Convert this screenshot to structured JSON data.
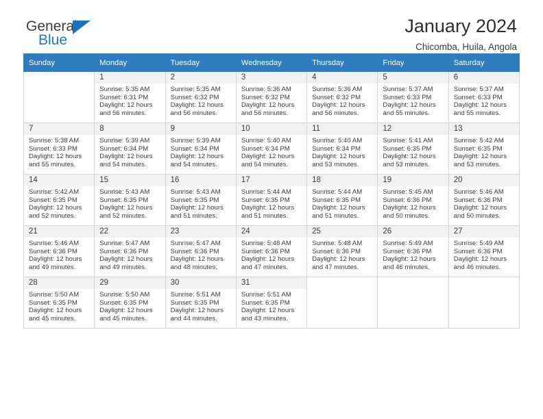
{
  "brand": {
    "line1": "General",
    "line2": "Blue",
    "triangle_icon": "blue-triangle-icon",
    "accent_color": "#1a72b8"
  },
  "header": {
    "title": "January 2024",
    "subtitle": "Chicomba, Huila, Angola"
  },
  "calendar": {
    "header_bg": "#2f7cbf",
    "weekday_headers": [
      "Sunday",
      "Monday",
      "Tuesday",
      "Wednesday",
      "Thursday",
      "Friday",
      "Saturday"
    ],
    "labels": {
      "sunrise": "Sunrise:",
      "sunset": "Sunset:",
      "daylight": "Daylight:"
    },
    "weeks": [
      [
        {
          "day": "",
          "lines": []
        },
        {
          "day": "1",
          "lines": [
            "Sunrise: 5:35 AM",
            "Sunset: 6:31 PM",
            "Daylight: 12 hours",
            "and 56 minutes."
          ]
        },
        {
          "day": "2",
          "lines": [
            "Sunrise: 5:35 AM",
            "Sunset: 6:32 PM",
            "Daylight: 12 hours",
            "and 56 minutes."
          ]
        },
        {
          "day": "3",
          "lines": [
            "Sunrise: 5:36 AM",
            "Sunset: 6:32 PM",
            "Daylight: 12 hours",
            "and 56 minutes."
          ]
        },
        {
          "day": "4",
          "lines": [
            "Sunrise: 5:36 AM",
            "Sunset: 6:32 PM",
            "Daylight: 12 hours",
            "and 56 minutes."
          ]
        },
        {
          "day": "5",
          "lines": [
            "Sunrise: 5:37 AM",
            "Sunset: 6:33 PM",
            "Daylight: 12 hours",
            "and 55 minutes."
          ]
        },
        {
          "day": "6",
          "lines": [
            "Sunrise: 5:37 AM",
            "Sunset: 6:33 PM",
            "Daylight: 12 hours",
            "and 55 minutes."
          ]
        }
      ],
      [
        {
          "day": "7",
          "lines": [
            "Sunrise: 5:38 AM",
            "Sunset: 6:33 PM",
            "Daylight: 12 hours",
            "and 55 minutes."
          ]
        },
        {
          "day": "8",
          "lines": [
            "Sunrise: 5:39 AM",
            "Sunset: 6:34 PM",
            "Daylight: 12 hours",
            "and 54 minutes."
          ]
        },
        {
          "day": "9",
          "lines": [
            "Sunrise: 5:39 AM",
            "Sunset: 6:34 PM",
            "Daylight: 12 hours",
            "and 54 minutes."
          ]
        },
        {
          "day": "10",
          "lines": [
            "Sunrise: 5:40 AM",
            "Sunset: 6:34 PM",
            "Daylight: 12 hours",
            "and 54 minutes."
          ]
        },
        {
          "day": "11",
          "lines": [
            "Sunrise: 5:40 AM",
            "Sunset: 6:34 PM",
            "Daylight: 12 hours",
            "and 53 minutes."
          ]
        },
        {
          "day": "12",
          "lines": [
            "Sunrise: 5:41 AM",
            "Sunset: 6:35 PM",
            "Daylight: 12 hours",
            "and 53 minutes."
          ]
        },
        {
          "day": "13",
          "lines": [
            "Sunrise: 5:42 AM",
            "Sunset: 6:35 PM",
            "Daylight: 12 hours",
            "and 53 minutes."
          ]
        }
      ],
      [
        {
          "day": "14",
          "lines": [
            "Sunrise: 5:42 AM",
            "Sunset: 6:35 PM",
            "Daylight: 12 hours",
            "and 52 minutes."
          ]
        },
        {
          "day": "15",
          "lines": [
            "Sunrise: 5:43 AM",
            "Sunset: 6:35 PM",
            "Daylight: 12 hours",
            "and 52 minutes."
          ]
        },
        {
          "day": "16",
          "lines": [
            "Sunrise: 5:43 AM",
            "Sunset: 6:35 PM",
            "Daylight: 12 hours",
            "and 51 minutes."
          ]
        },
        {
          "day": "17",
          "lines": [
            "Sunrise: 5:44 AM",
            "Sunset: 6:35 PM",
            "Daylight: 12 hours",
            "and 51 minutes."
          ]
        },
        {
          "day": "18",
          "lines": [
            "Sunrise: 5:44 AM",
            "Sunset: 6:35 PM",
            "Daylight: 12 hours",
            "and 51 minutes."
          ]
        },
        {
          "day": "19",
          "lines": [
            "Sunrise: 5:45 AM",
            "Sunset: 6:36 PM",
            "Daylight: 12 hours",
            "and 50 minutes."
          ]
        },
        {
          "day": "20",
          "lines": [
            "Sunrise: 5:46 AM",
            "Sunset: 6:36 PM",
            "Daylight: 12 hours",
            "and 50 minutes."
          ]
        }
      ],
      [
        {
          "day": "21",
          "lines": [
            "Sunrise: 5:46 AM",
            "Sunset: 6:36 PM",
            "Daylight: 12 hours",
            "and 49 minutes."
          ]
        },
        {
          "day": "22",
          "lines": [
            "Sunrise: 5:47 AM",
            "Sunset: 6:36 PM",
            "Daylight: 12 hours",
            "and 49 minutes."
          ]
        },
        {
          "day": "23",
          "lines": [
            "Sunrise: 5:47 AM",
            "Sunset: 6:36 PM",
            "Daylight: 12 hours",
            "and 48 minutes."
          ]
        },
        {
          "day": "24",
          "lines": [
            "Sunrise: 5:48 AM",
            "Sunset: 6:36 PM",
            "Daylight: 12 hours",
            "and 47 minutes."
          ]
        },
        {
          "day": "25",
          "lines": [
            "Sunrise: 5:48 AM",
            "Sunset: 6:36 PM",
            "Daylight: 12 hours",
            "and 47 minutes."
          ]
        },
        {
          "day": "26",
          "lines": [
            "Sunrise: 5:49 AM",
            "Sunset: 6:36 PM",
            "Daylight: 12 hours",
            "and 46 minutes."
          ]
        },
        {
          "day": "27",
          "lines": [
            "Sunrise: 5:49 AM",
            "Sunset: 6:36 PM",
            "Daylight: 12 hours",
            "and 46 minutes."
          ]
        }
      ],
      [
        {
          "day": "28",
          "lines": [
            "Sunrise: 5:50 AM",
            "Sunset: 6:35 PM",
            "Daylight: 12 hours",
            "and 45 minutes."
          ]
        },
        {
          "day": "29",
          "lines": [
            "Sunrise: 5:50 AM",
            "Sunset: 6:35 PM",
            "Daylight: 12 hours",
            "and 45 minutes."
          ]
        },
        {
          "day": "30",
          "lines": [
            "Sunrise: 5:51 AM",
            "Sunset: 6:35 PM",
            "Daylight: 12 hours",
            "and 44 minutes."
          ]
        },
        {
          "day": "31",
          "lines": [
            "Sunrise: 5:51 AM",
            "Sunset: 6:35 PM",
            "Daylight: 12 hours",
            "and 43 minutes."
          ]
        },
        {
          "day": "",
          "lines": []
        },
        {
          "day": "",
          "lines": []
        },
        {
          "day": "",
          "lines": []
        }
      ]
    ]
  }
}
